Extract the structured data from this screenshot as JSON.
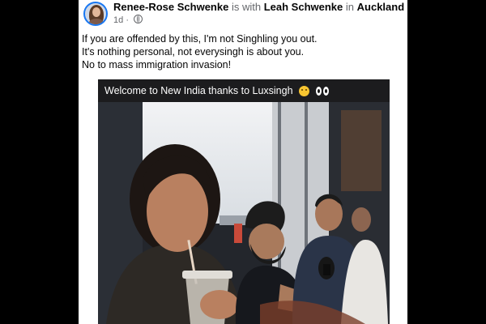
{
  "post": {
    "author": "Renee-Rose Schwenke",
    "with_text": "is with",
    "tagged": "Leah Schwenke",
    "in_text": "in",
    "location": "Auckland, Ne...",
    "time": "1d",
    "privacy_icon": "globe-icon",
    "lines": [
      "If you are offended by this, I'm not Singhling you out.",
      "It's nothing personal, not everysingh is about you.",
      "No to mass immigration invasion!"
    ]
  },
  "image": {
    "caption": "Welcome to New India thanks to Luxsingh",
    "caption_emojis": [
      "zipper-mouth-face-icon",
      "eyes-icon"
    ]
  },
  "colors": {
    "link_blue": "#1877f2",
    "text": "#050505",
    "muted": "#65676b",
    "caption_bg": "#1c1c1e"
  }
}
